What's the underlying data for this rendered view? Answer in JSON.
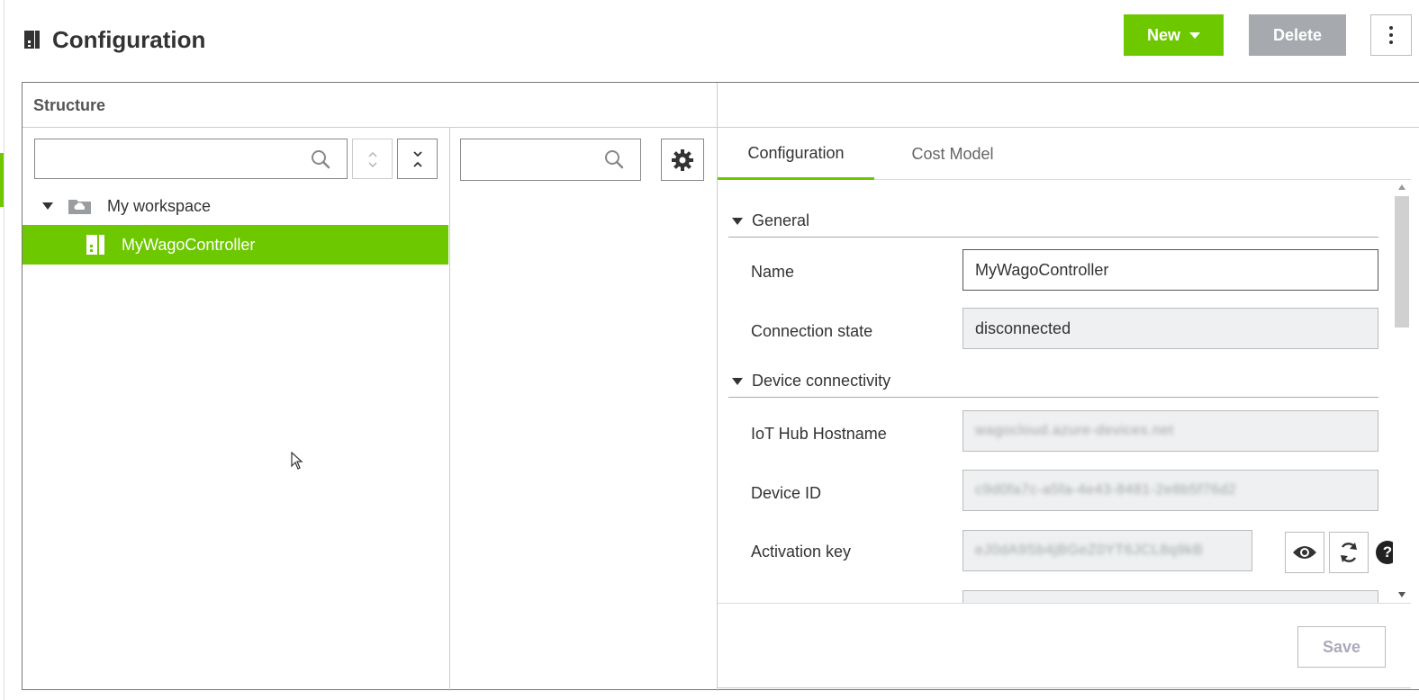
{
  "header": {
    "title": "Configuration",
    "new_label": "New",
    "delete_label": "Delete"
  },
  "structure": {
    "title": "Structure",
    "search_placeholder": "",
    "tree": {
      "root_label": "My workspace",
      "child_label": "MyWagoController"
    }
  },
  "middle": {
    "search_placeholder": ""
  },
  "tabs": [
    {
      "label": "Configuration",
      "active": true
    },
    {
      "label": "Cost Model",
      "active": false
    }
  ],
  "sections": {
    "general": "General",
    "device_connectivity": "Device connectivity"
  },
  "fields": {
    "name_label": "Name",
    "name_value": "MyWagoController",
    "connection_state_label": "Connection state",
    "connection_state_value": "disconnected",
    "iot_hub_label": "IoT Hub Hostname",
    "iot_hub_value": "wagocloud.azure-devices.net",
    "device_id_label": "Device ID",
    "device_id_value": "c9d0fa7c-a5fa-4e43-8481-2e8b5f76d2",
    "activation_key_label": "Activation key",
    "activation_key_value": "eJ0dA9Sb4jBGeZ0YT6JCL8q9kB"
  },
  "footer": {
    "save_label": "Save"
  },
  "colors": {
    "accent": "#6ec800",
    "delete_bg": "#a6a9ae",
    "readonly_bg": "#eef0f1"
  },
  "icons": [
    "device-icon",
    "search-icon",
    "sort-icon",
    "collapse-icon",
    "folder-cloud-icon",
    "gear-icon",
    "eye-icon",
    "refresh-icon",
    "help-icon",
    "more-vertical-icon",
    "caret-down-icon"
  ]
}
